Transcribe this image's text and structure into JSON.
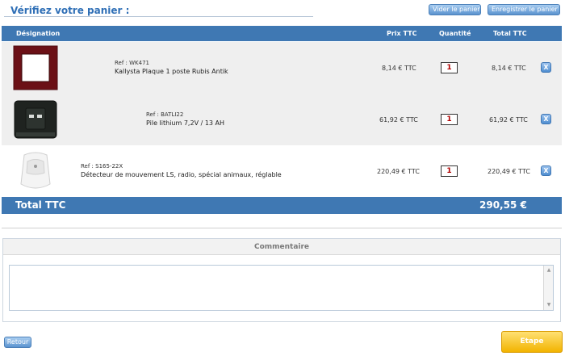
{
  "header": {
    "title": "Vérifiez votre panier :",
    "empty_button": "Vider le panier",
    "save_button": "Enregistrer le panier"
  },
  "table": {
    "columns": {
      "designation": "Désignation",
      "unit_price": "Prix TTC",
      "quantity": "Quantité",
      "total": "Total TTC"
    },
    "rows": [
      {
        "ref": "Ref : WK471",
        "name": "Kallysta Plaque 1 poste Rubis Antik",
        "unit_price": "8,14 € TTC",
        "quantity": "1",
        "total": "8,14 € TTC",
        "delete_label": "X",
        "image_icon": "wall-plate-icon"
      },
      {
        "ref": "Ref : BATLI22",
        "name": "Pile lithium 7,2V / 13 AH",
        "unit_price": "61,92 € TTC",
        "quantity": "1",
        "total": "61,92 € TTC",
        "delete_label": "X",
        "image_icon": "battery-icon"
      },
      {
        "ref": "Ref : S165-22X",
        "name": "Détecteur de mouvement LS, radio, spécial animaux, réglable",
        "unit_price": "220,49 € TTC",
        "quantity": "1",
        "total": "220,49 € TTC",
        "delete_label": "X",
        "image_icon": "motion-detector-icon"
      }
    ]
  },
  "summary": {
    "label": "Total TTC",
    "value": "290,55 €"
  },
  "comment": {
    "title": "Commentaire",
    "value": ""
  },
  "footer": {
    "back_button": "Retour",
    "next_button": "Etape suivante"
  },
  "colors": {
    "accent": "#3f78b3",
    "title": "#2f6fb6",
    "next_button": "#f2b300",
    "quantity_text": "#b00000"
  }
}
